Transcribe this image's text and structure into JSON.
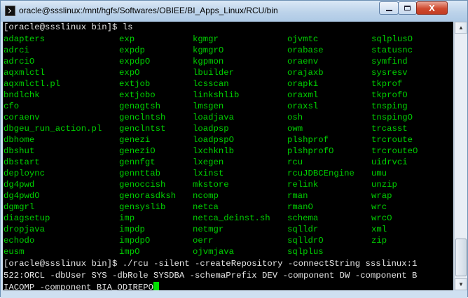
{
  "window": {
    "title": "oracle@ssslinux:/mnt/hgfs/Softwares/OBIEE/BI_Apps_Linux/RCU/bin",
    "close_label": "X"
  },
  "terminal": {
    "prompt1": "[oracle@ssslinux bin]$ ls",
    "listing": {
      "col1": [
        "adapters",
        "adrci",
        "adrciO",
        "aqxmlctl",
        "aqxmlctl.pl",
        "bndlchk",
        "cfo",
        "coraenv",
        "dbgeu_run_action.pl",
        "dbhome",
        "dbshut",
        "dbstart",
        "deploync",
        "dg4pwd",
        "dg4pwdO",
        "dgmgrl",
        "diagsetup",
        "dropjava",
        "echodo",
        "eusm"
      ],
      "col2": [
        "exp",
        "expdp",
        "expdpO",
        "expO",
        "extjob",
        "extjobo",
        "genagtsh",
        "genclntsh",
        "genclntst",
        "genezi",
        "geneziO",
        "gennfgt",
        "gennttab",
        "genoccish",
        "genorasdksh",
        "gensyslib",
        "imp",
        "impdp",
        "impdpO",
        "impO"
      ],
      "col3": [
        "kgmgr",
        "kgmgrO",
        "kgpmon",
        "lbuilder",
        "lcsscan",
        "linkshlib",
        "lmsgen",
        "loadjava",
        "loadpsp",
        "loadpspO",
        "lxchknlb",
        "lxegen",
        "lxinst",
        "mkstore",
        "ncomp",
        "netca",
        "netca_deinst.sh",
        "netmgr",
        "oerr",
        "ojvmjava"
      ],
      "col4": [
        "ojvmtc",
        "orabase",
        "oraenv",
        "orajaxb",
        "orapki",
        "oraxml",
        "oraxsl",
        "osh",
        "owm",
        "plshprof",
        "plshprofO",
        "rcu",
        "rcuJDBCEngine",
        "relink",
        "rman",
        "rmanO",
        "schema",
        "sqlldr",
        "sqlldrO",
        "sqlplus"
      ],
      "col5": [
        "sqlplusO",
        "statusnc",
        "symfind",
        "sysresv",
        "tkprof",
        "tkprofO",
        "tnsping",
        "tnspingO",
        "trcasst",
        "trcroute",
        "trcrouteO",
        "uidrvci",
        "umu",
        "unzip",
        "wrap",
        "wrc",
        "wrcO",
        "xml",
        "zip",
        ""
      ]
    },
    "command_lines": [
      "[oracle@ssslinux bin]$ ./rcu -silent -createRepository -connectString ssslinux:1",
      "522:ORCL -dbUser SYS -dbRole SYSDBA -schemaPrefix DEV -component DW -component B",
      "IACOMP -component BIA_ODIREPO"
    ]
  }
}
